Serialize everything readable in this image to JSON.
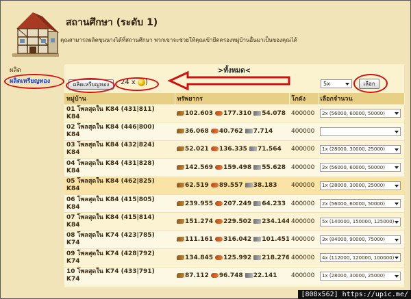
{
  "header": {
    "title": "สถานศึกษา (ระดับ 1)",
    "description": "คุณสามารถผลิตขุนนางได้ที่สถานศึกษา พวกเขาจะช่วยให้คุณเข้ายึดครองหมู่บ้านอื่นมาเป็นของคุณได้"
  },
  "left_menu": {
    "items": [
      {
        "label": "ผลิต"
      },
      {
        "label": "ผลิตเหรียญทอง"
      }
    ]
  },
  "panel": {
    "heading": ">ทั้งหมด<",
    "mint_button": "ผลิตเหรียญทอง",
    "coin_count": "24 x",
    "coin_suffix": ")",
    "amount_select": "5x",
    "select_button": "เลือก"
  },
  "table": {
    "headers": [
      "หมู่บ้าน",
      "ทรัพยากร",
      "โกดัง",
      "เลือกจำนวน"
    ],
    "rows": [
      {
        "name": "01 โพลสุดใน K84 (431|811)",
        "continent": "K84",
        "wood": "102.603",
        "clay": "177.310",
        "iron": "54.078",
        "storage": "400000",
        "choice": "2x (56000, 60000, 50000)",
        "style": "alt"
      },
      {
        "name": "02 โพลสุดใน K84 (446|800)",
        "continent": "K84",
        "wood": "36.068",
        "clay": "40.762",
        "iron": "7.714",
        "storage": "400000",
        "choice": "",
        "style": "norm"
      },
      {
        "name": "03 โพลสุดใน K84 (432|824)",
        "continent": "K84",
        "wood": "52.021",
        "clay": "136.335",
        "iron": "71.564",
        "storage": "400000",
        "choice": "1x (28000, 30000, 25000)",
        "style": "alt"
      },
      {
        "name": "04 โพลสุดใน K84 (431|828)",
        "continent": "K84",
        "wood": "142.569",
        "clay": "159.498",
        "iron": "55.628",
        "storage": "400000",
        "choice": "2x (56000, 60000, 50000)",
        "style": "norm"
      },
      {
        "name": "05 โพลสุดใน K84 (462|825)",
        "continent": "K84",
        "wood": "62.519",
        "clay": "89.557",
        "iron": "38.183",
        "storage": "400000",
        "choice": "1x (28000, 30000, 25000)",
        "style": "hl"
      },
      {
        "name": "06 โพลสุดใน K84 (415|805)",
        "continent": "K84",
        "wood": "239.955",
        "clay": "207.249",
        "iron": "64.233",
        "storage": "400000",
        "choice": "2x (56000, 60000, 50000)",
        "style": "norm"
      },
      {
        "name": "07 โพลสุดใน K84 (415|814)",
        "continent": "K84",
        "wood": "151.274",
        "clay": "229.502",
        "iron": "234.144",
        "storage": "400000",
        "choice": "5x (140000, 150000, 125000)",
        "style": "alt"
      },
      {
        "name": "08 โพลสุดใน K74 (423|785)",
        "continent": "K74",
        "wood": "111.161",
        "clay": "316.042",
        "iron": "101.451",
        "storage": "400000",
        "choice": "3x (84000, 90000, 75000)",
        "style": "norm"
      },
      {
        "name": "09 โพลสุดใน K74 (428|792)",
        "continent": "K74",
        "wood": "134.845",
        "clay": "125.992",
        "iron": "218.276",
        "storage": "400000",
        "choice": "4x (112000, 120000, 100000)",
        "style": "alt"
      },
      {
        "name": "10 โพลสุดใน K74 (433|791)",
        "continent": "K74",
        "wood": "87.112",
        "clay": "96.748",
        "iron": "22.141",
        "storage": "400000",
        "choice": "1x (28000, 30000, 25000)",
        "style": "norm"
      }
    ]
  },
  "watermark": "[808x562] https://upic.me/",
  "colors": {
    "annotation": "#d01010",
    "link": "#1c3fc4",
    "background": "#f1e4b8"
  }
}
